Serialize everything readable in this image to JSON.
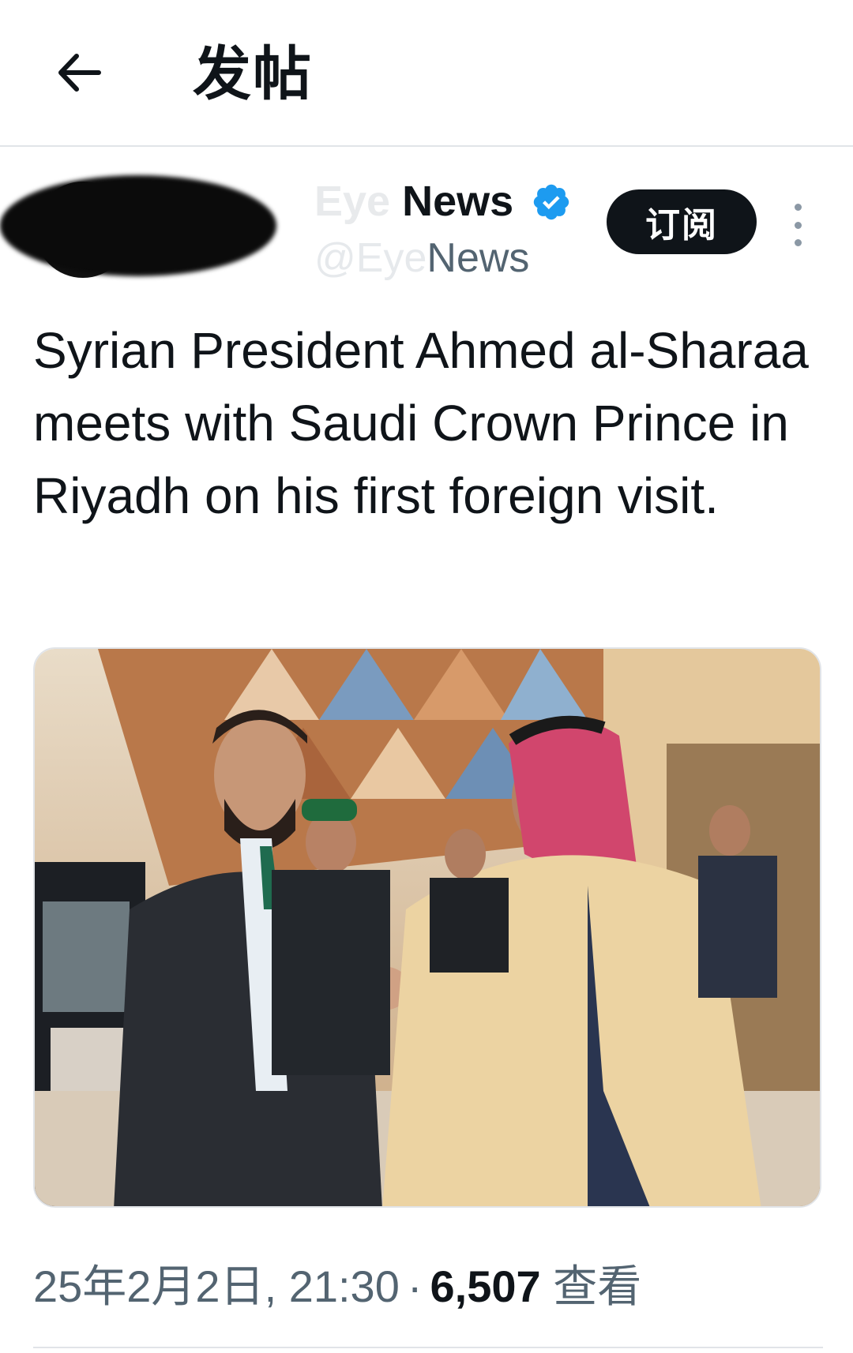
{
  "header": {
    "title": "发帖",
    "back_icon": "arrow-left-icon"
  },
  "author": {
    "display_name_faded": "Eye ",
    "display_name": "News",
    "handle_faded": "@Eye",
    "handle": "News",
    "verified_icon": "verified-badge-icon",
    "verified_color": "#1d9bf0",
    "subscribe_label": "订阅",
    "more_icon": "more-vertical-icon"
  },
  "tweet": {
    "text": "Syrian President Ahmed al-Sharaa meets with Saudi Crown Prince in Riyadh on his first foreign visit."
  },
  "media": {
    "type": "photo"
  },
  "meta": {
    "timestamp": "25年2月2日, 21:30",
    "separator": "·",
    "views_count": "6,507",
    "views_label": "查看"
  }
}
